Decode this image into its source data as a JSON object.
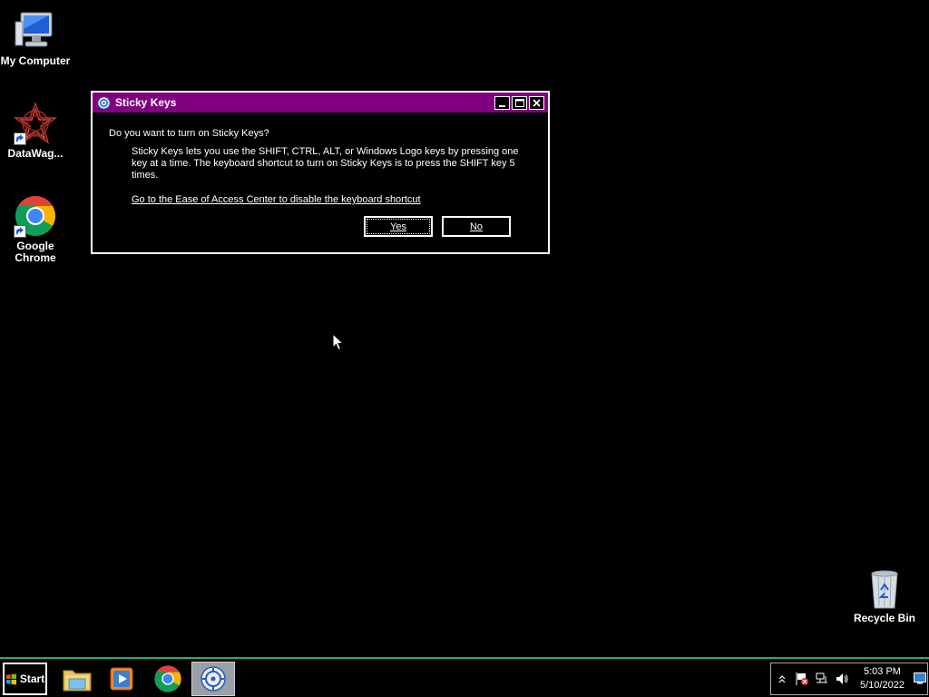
{
  "desktop": {
    "icons": [
      {
        "label": "My Computer"
      },
      {
        "label": "DataWag..."
      },
      {
        "label": "Google Chrome"
      },
      {
        "label": "Recycle Bin"
      }
    ]
  },
  "dialog": {
    "title": "Sticky Keys",
    "question": "Do you want to turn on Sticky Keys?",
    "description": "Sticky Keys lets you use the SHIFT, CTRL, ALT, or Windows Logo keys by pressing one key at a time. The keyboard shortcut to turn on Sticky Keys is to press the SHIFT key 5 times.",
    "link": "Go to the Ease of Access Center to disable the keyboard shortcut",
    "yes_label": "Yes",
    "no_label": "No",
    "titlebar_color": "#800080"
  },
  "taskbar": {
    "start_label": "Start",
    "apps": [
      "folder-icon",
      "media-player-icon",
      "chrome-icon",
      "ease-of-access-icon"
    ],
    "active_app": "ease-of-access-icon",
    "clock_time": "5:03 PM",
    "clock_date": "5/10/2022",
    "accent_color": "#22aa77"
  }
}
